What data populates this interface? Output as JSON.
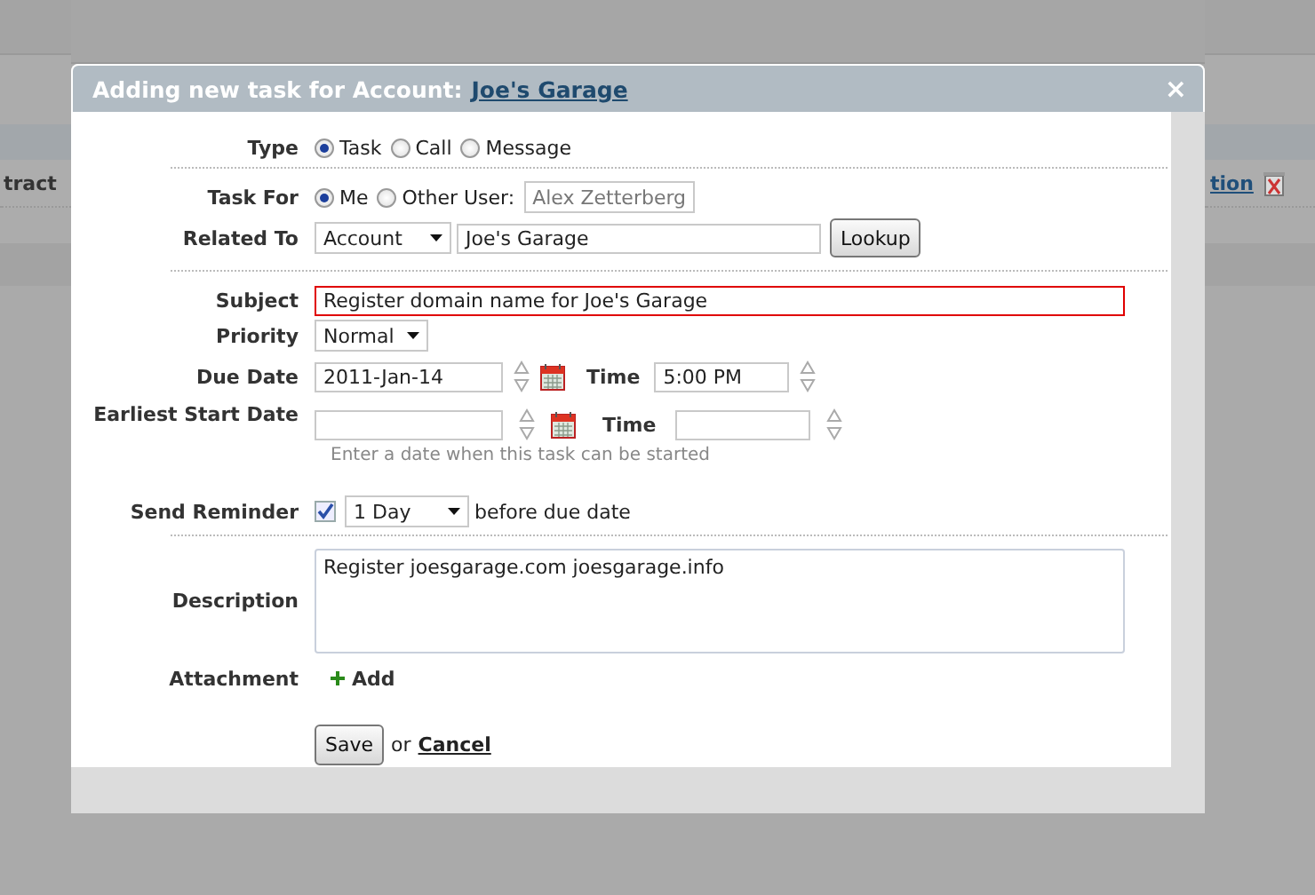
{
  "background": {
    "left_text": "tract",
    "right_link": "tion"
  },
  "dialog": {
    "title": "Adding new task for Account:",
    "title_link": "Joe's Garage",
    "close": "×"
  },
  "type": {
    "label": "Type",
    "options": [
      {
        "label": "Task",
        "selected": true
      },
      {
        "label": "Call",
        "selected": false
      },
      {
        "label": "Message",
        "selected": false
      }
    ]
  },
  "task_for": {
    "label": "Task For",
    "options": [
      {
        "label": "Me",
        "selected": true
      },
      {
        "label": "Other User:",
        "selected": false
      }
    ],
    "user_select": {
      "value": "Alex Zetterberg",
      "disabled": true
    }
  },
  "related_to": {
    "label": "Related To",
    "type_value": "Account",
    "value": "Joe's Garage",
    "button": "Lookup"
  },
  "subject": {
    "label": "Subject",
    "value": "Register domain name for Joe's Garage",
    "invalid": true
  },
  "priority": {
    "label": "Priority",
    "value": "Normal"
  },
  "due": {
    "label": "Due Date",
    "date": "2011-Jan-14",
    "time_label": "Time",
    "time": "5:00 PM"
  },
  "start": {
    "label": "Earliest Start Date",
    "time_label": "Time",
    "hint": "Enter a date when this task can be started"
  },
  "reminder": {
    "label": "Send Reminder",
    "checked": true,
    "value": "1 Day",
    "suffix": "before due date"
  },
  "description": {
    "label": "Description",
    "value": "Register joesgarage.com joesgarage.info"
  },
  "attachment": {
    "label": "Attachment",
    "action": "Add"
  },
  "actions": {
    "save": "Save",
    "or": "or",
    "cancel": "Cancel"
  }
}
